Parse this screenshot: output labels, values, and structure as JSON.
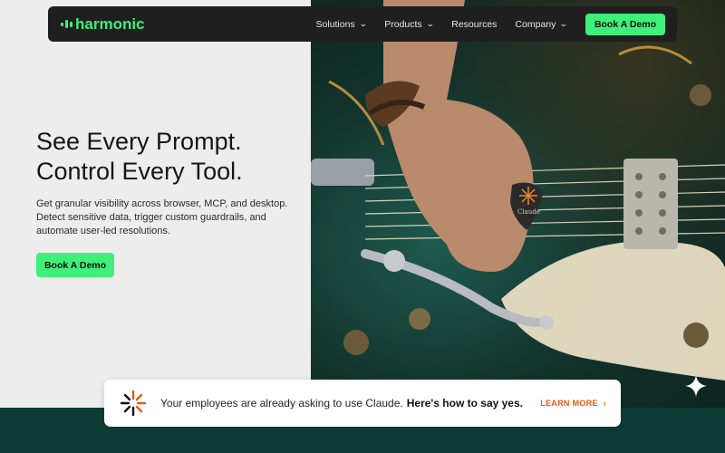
{
  "nav": {
    "logo_text": "harmonic",
    "items": [
      {
        "label": "Solutions",
        "has_dropdown": true
      },
      {
        "label": "Products",
        "has_dropdown": true
      },
      {
        "label": "Resources",
        "has_dropdown": false
      },
      {
        "label": "Company",
        "has_dropdown": true
      }
    ],
    "cta_label": "Book A Demo"
  },
  "hero": {
    "headline_line1": "See Every Prompt.",
    "headline_line2": "Control Every Tool.",
    "subtext": "Get granular visibility across browser, MCP, and desktop. Detect sensitive data, trigger custom guardrails, and automate user-led resolutions.",
    "cta_label": "Book A Demo",
    "pick_text": "Claude"
  },
  "banner": {
    "text": "Your employees are already asking to use Claude.",
    "emphasis": "Here's how to say yes.",
    "link_label": "LEARN MORE",
    "link_arrow": "›"
  },
  "colors": {
    "accent": "#3ef07a",
    "nav_bg": "#1f1f1f",
    "band": "#0d3d36",
    "link": "#e8590c"
  },
  "icons": [
    "chevron-down-icon",
    "burst-logo-icon",
    "sparkle-icon",
    "chevron-right-icon"
  ]
}
